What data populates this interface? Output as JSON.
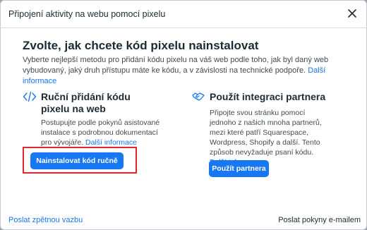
{
  "dialog": {
    "title": "Připojení aktivity na webu pomocí pixelu",
    "heading": "Zvolte, jak chcete kód pixelu nainstalovat",
    "description": "Vyberte nejlepší metodu pro přidání kódu pixelu na váš web podle toho, jak byl daný web vybudovaný, jaký druh přístupu máte ke kódu, a v závislosti na technické podpoře.",
    "description_link": "Další informace"
  },
  "manual": {
    "icon": "code-icon",
    "title": "Ruční přidání kódu pixelu na web",
    "text": "Postupujte podle pokynů asistované instalace s podrobnou dokumentací pro vývojáře.",
    "link": "Další informace",
    "button": "Nainstalovat kód ručně"
  },
  "partner": {
    "icon": "handshake-icon",
    "title": "Použít integraci partnera",
    "text": "Připojte svou stránku pomocí jednoho z našich mnoha partnerů, mezi které patří Squarespace, Wordpress, Shopify a další. Tento způsob nevyžaduje psaní kódu.",
    "link": "Další informace",
    "button": "Použít partnera"
  },
  "footer": {
    "feedback": "Poslat zpětnou vazbu",
    "email": "Poslat pokyny e-mailem"
  },
  "colors": {
    "accent": "#1877f2",
    "highlight": "#e0262e"
  }
}
